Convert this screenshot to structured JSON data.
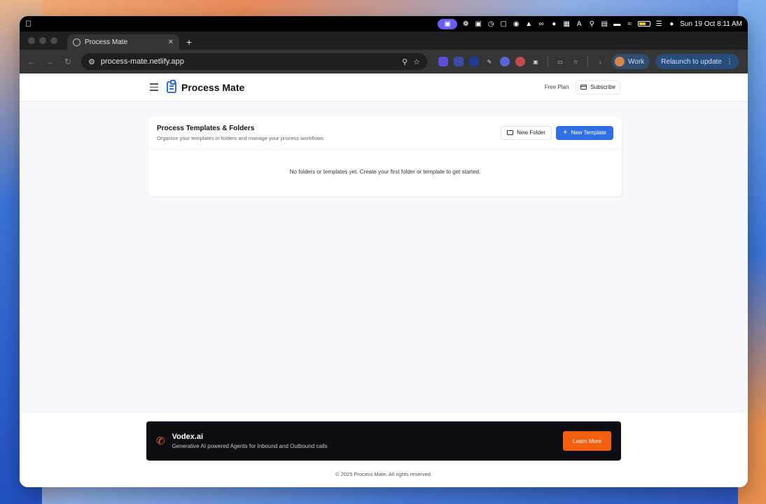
{
  "menubar": {
    "date_time": "Sun 19 Oct  8:11 AM"
  },
  "browser": {
    "tab_title": "Process Mate",
    "url": "process-mate.netlify.app",
    "profile_label": "Work",
    "relaunch_label": "Relaunch to update"
  },
  "header": {
    "brand": "Process Mate",
    "plan": "Free Plan",
    "subscribe_label": "Subscribe"
  },
  "card": {
    "title": "Process Templates & Folders",
    "subtitle": "Organize your templates in folders and manage your process workflows",
    "new_folder_label": "New Folder",
    "new_template_label": "New Template",
    "empty_message": "No folders or templates yet. Create your first folder or template to get started."
  },
  "promo": {
    "title": "Vodex.ai",
    "subtitle": "Generative AI powered Agents for Inbound and Outbound calls",
    "cta_label": "Learn More"
  },
  "footer": {
    "copyright": "© 2025 Process Mate. All rights reserved."
  },
  "colors": {
    "accent": "#2f6fe6",
    "promo_cta": "#f2600f"
  }
}
